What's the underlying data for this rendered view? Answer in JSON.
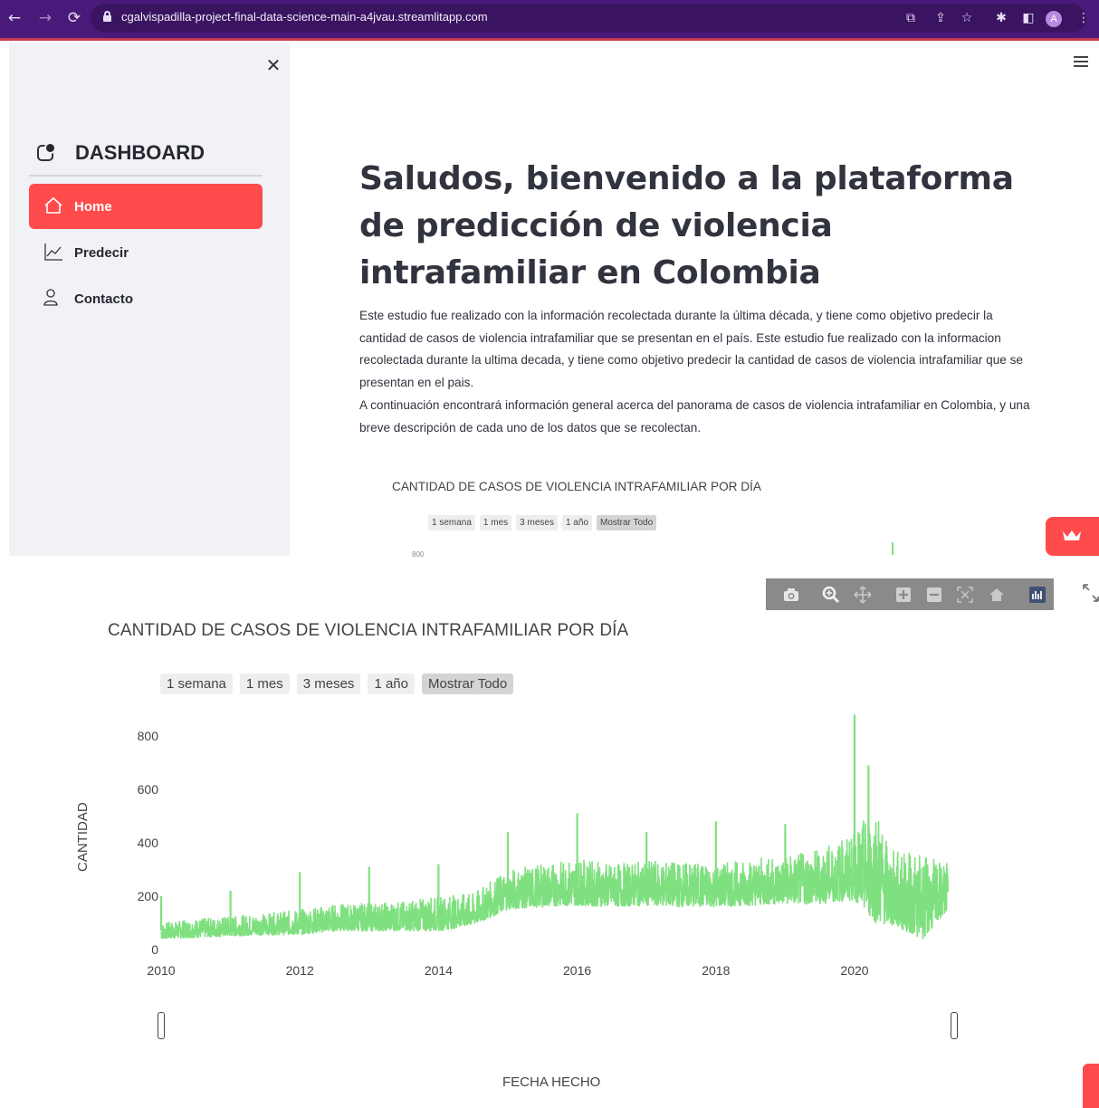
{
  "browser": {
    "url": "cgalvispadilla-project-final-data-science-main-a4jvau.streamlitapp.com",
    "avatar_letter": "A"
  },
  "sidebar": {
    "title": "DASHBOARD",
    "items": [
      {
        "label": "Home",
        "active": true,
        "icon": "home-icon"
      },
      {
        "label": "Predecir",
        "active": false,
        "icon": "line-chart-icon"
      },
      {
        "label": "Contacto",
        "active": false,
        "icon": "person-icon"
      }
    ]
  },
  "main": {
    "headline": "Saludos, bienvenido a la plataforma de predicción de violencia intrafamiliar en Colombia",
    "intro_1": "Este estudio fue realizado con la información recolectada durante la última década, y tiene como objetivo predecir la cantidad de casos de violencia intrafamiliar que se presentan en el país. Este estudio fue realizado con la informacion recolectada durante la ultima decada, y tiene como objetivo predecir la cantidad de casos de violencia intrafamiliar que se presentan en el pais.",
    "intro_2": "A continuación encontrará información general acerca del panorama de casos de violencia intrafamiliar en Colombia, y una breve descripción de cada uno de los datos que se recolectan."
  },
  "chart": {
    "range_buttons": [
      "1 semana",
      "1 mes",
      "3 meses",
      "1 año",
      "Mostrar Todo"
    ],
    "selected_range": "Mostrar Todo",
    "small_tick_label": "800"
  },
  "colors": {
    "accent": "#ff4b4b",
    "series": "#7fe07f",
    "browser_bar": "#4a1a7a"
  },
  "chart_data": {
    "type": "line",
    "title": "CANTIDAD DE CASOS DE VIOLENCIA INTRAFAMILIAR POR DÍA",
    "xlabel": "FECHA HECHO",
    "ylabel": "CANTIDAD",
    "xlim": [
      2010.0,
      2021.4
    ],
    "ylim": [
      0,
      880
    ],
    "x_ticks": [
      "2010",
      "2012",
      "2014",
      "2016",
      "2018",
      "2020"
    ],
    "y_ticks": [
      "0",
      "200",
      "400",
      "600",
      "800"
    ],
    "grid": false,
    "series": [
      {
        "x": [
          2010.0,
          2010.5,
          2011.0,
          2011.5,
          2012.0,
          2012.5,
          2013.0,
          2013.5,
          2014.0,
          2014.5,
          2015.0,
          2015.5,
          2016.0,
          2016.5,
          2017.0,
          2017.5,
          2018.0,
          2018.5,
          2019.0,
          2019.5,
          2020.0,
          2020.3,
          2020.5,
          2021.0,
          2021.35
        ],
        "y_mid": [
          70,
          80,
          90,
          100,
          110,
          125,
          125,
          130,
          140,
          150,
          225,
          230,
          245,
          230,
          240,
          245,
          240,
          245,
          255,
          265,
          300,
          330,
          240,
          220,
          240
        ],
        "y_low": [
          40,
          45,
          50,
          55,
          55,
          70,
          70,
          70,
          70,
          90,
          150,
          160,
          165,
          160,
          165,
          160,
          160,
          165,
          170,
          170,
          185,
          100,
          90,
          40,
          150
        ],
        "y_high": [
          100,
          115,
          125,
          135,
          150,
          170,
          175,
          180,
          200,
          210,
          300,
          320,
          340,
          320,
          330,
          330,
          320,
          340,
          350,
          380,
          430,
          560,
          380,
          350,
          320
        ]
      }
    ],
    "spikes": [
      {
        "x": 2010.0,
        "y": 200
      },
      {
        "x": 2011.0,
        "y": 220
      },
      {
        "x": 2012.0,
        "y": 290
      },
      {
        "x": 2013.0,
        "y": 310
      },
      {
        "x": 2014.0,
        "y": 320
      },
      {
        "x": 2015.0,
        "y": 440
      },
      {
        "x": 2016.0,
        "y": 510
      },
      {
        "x": 2017.0,
        "y": 440
      },
      {
        "x": 2018.0,
        "y": 480
      },
      {
        "x": 2019.0,
        "y": 470
      },
      {
        "x": 2020.0,
        "y": 880
      },
      {
        "x": 2020.2,
        "y": 690
      }
    ]
  }
}
